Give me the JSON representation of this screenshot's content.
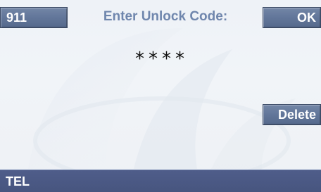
{
  "buttons": {
    "emergency_label": "911",
    "ok_label": "OK",
    "delete_label": "Delete"
  },
  "prompt": {
    "title": "Enter Unlock Code:"
  },
  "code_entry": {
    "masked_value": "****"
  },
  "status_bar": {
    "mode_label": "TEL"
  },
  "colors": {
    "button_fill": "#62769a",
    "prompt_text": "#6f86ad",
    "status_bar": "#4b5984",
    "background": "#eef2f7"
  }
}
